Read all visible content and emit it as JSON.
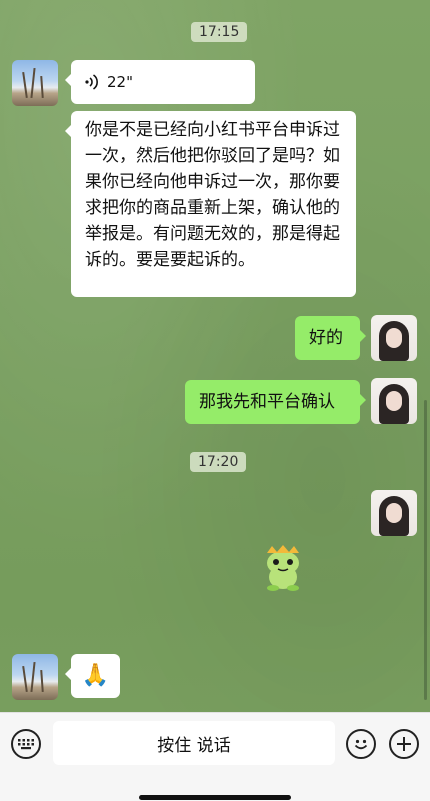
{
  "messages": {
    "time1": "17:15",
    "voice_duration": "22\"",
    "incoming_text": "你是不是已经向小红书平台申诉过一次，然后他把你驳回了是吗？如果你已经向他申诉过一次，那你要求把你的商品重新上架，确认他的举报是。有问题无效的，那是得起诉的。要是要起诉的。",
    "outgoing_1": "好的",
    "outgoing_2": "那我先和平台确认",
    "time2": "17:20",
    "reaction_emoji": "🙏"
  },
  "input_bar": {
    "hold_to_talk_label": "按住 说话"
  },
  "colors": {
    "outgoing_bubble": "#95ec69",
    "incoming_bubble": "#ffffff",
    "chat_background": "#7aa061"
  }
}
